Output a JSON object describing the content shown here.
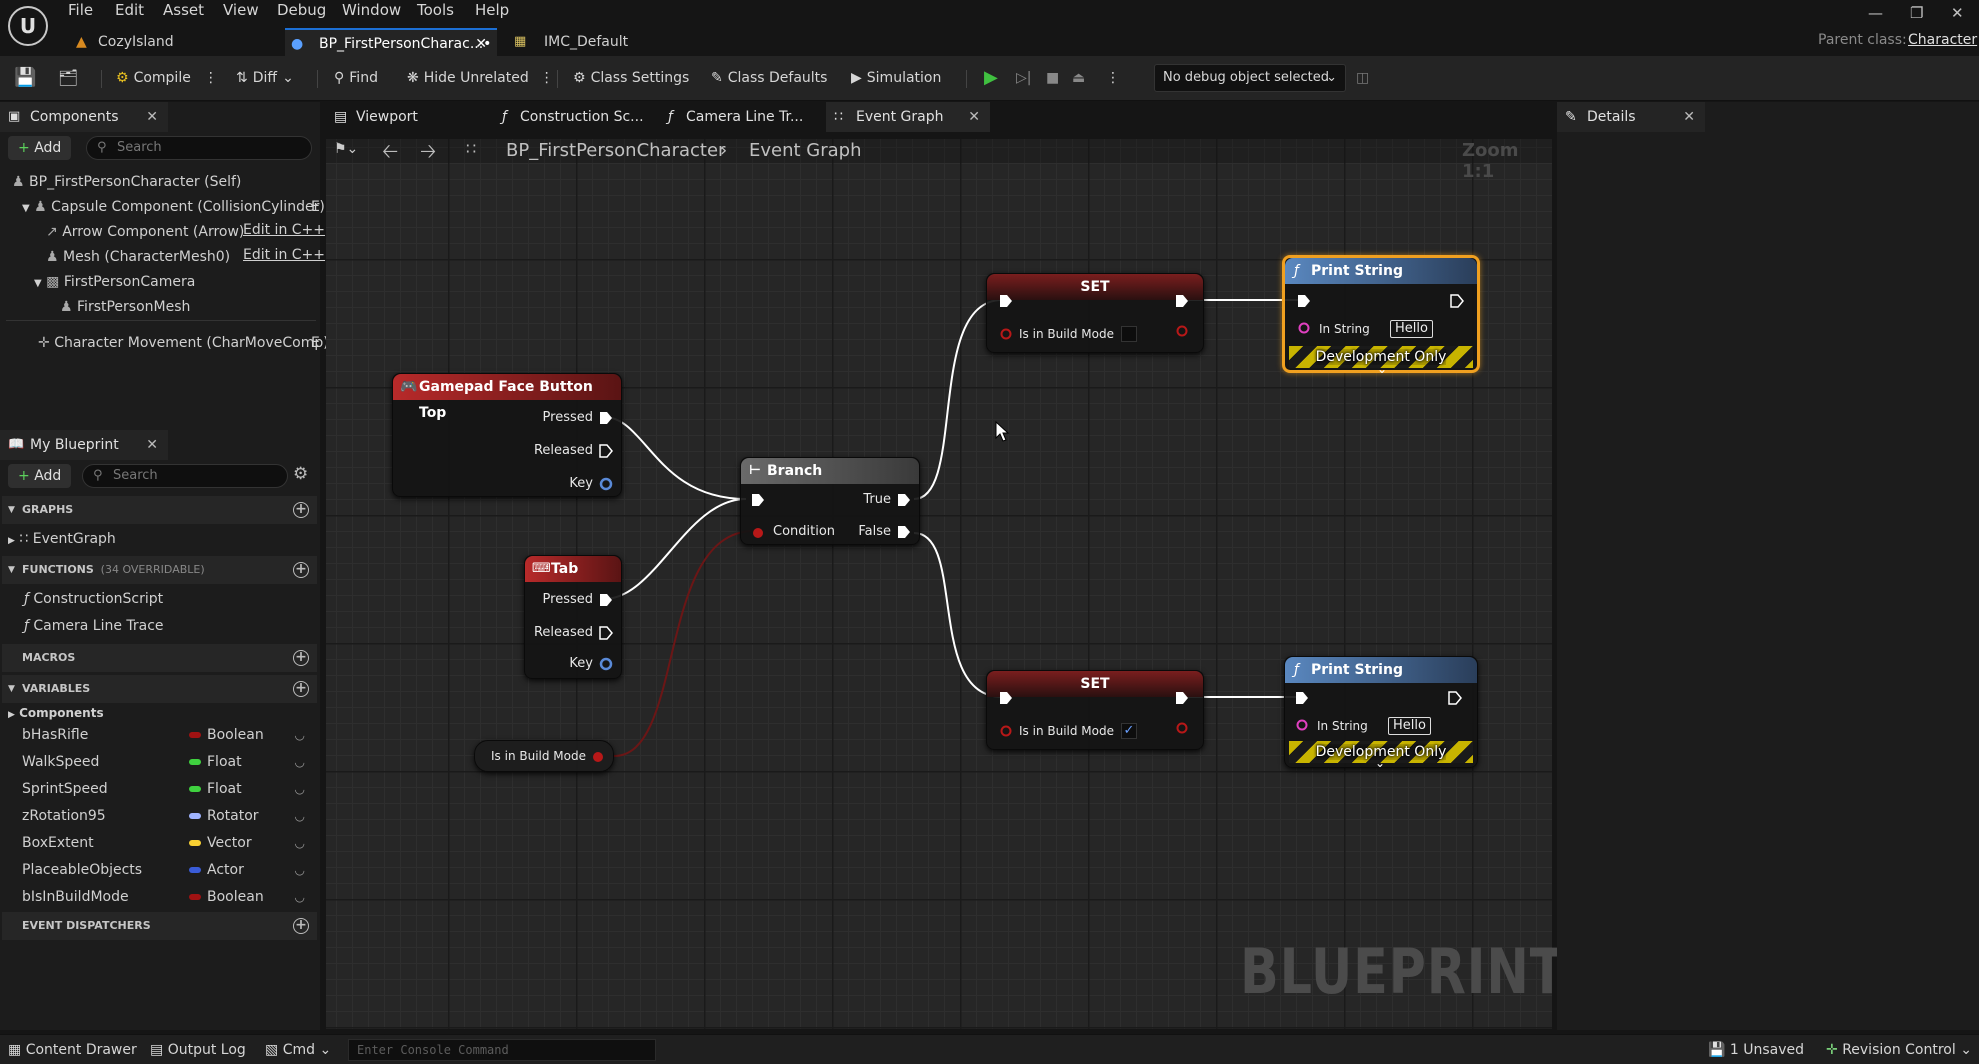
{
  "menu": [
    "File",
    "Edit",
    "Asset",
    "View",
    "Debug",
    "Window",
    "Tools",
    "Help"
  ],
  "doc_tabs": [
    {
      "label": "CozyIsland"
    },
    {
      "label": "BP_FirstPersonCharac...•"
    },
    {
      "label": "IMC_Default"
    }
  ],
  "parent_class": {
    "label": "Parent class:",
    "value": "Character"
  },
  "toolbar": {
    "compile": "Compile",
    "diff": "Diff",
    "find": "Find",
    "hide_unrelated": "Hide Unrelated",
    "class_settings": "Class Settings",
    "class_defaults": "Class Defaults",
    "simulation": "Simulation",
    "debug_object": "No debug object selected"
  },
  "components_panel": {
    "title": "Components",
    "add": "Add",
    "search_placeholder": "Search",
    "items": [
      "BP_FirstPersonCharacter (Self)",
      "Capsule Component (CollisionCylinder)",
      "Arrow Component (Arrow)",
      "Mesh (CharacterMesh0)",
      "FirstPersonCamera",
      "FirstPersonMesh",
      "Character Movement (CharMoveComp)"
    ],
    "edit_in_cpp": "Edit in C++",
    "trunc_mark": "E"
  },
  "my_blueprint": {
    "title": "My Blueprint",
    "add": "Add",
    "search_placeholder": "Search",
    "graphs_header": "GRAPHS",
    "event_graph": "EventGraph",
    "functions_header": "FUNCTIONS",
    "functions_note": "(34 OVERRIDABLE)",
    "functions": [
      "ConstructionScript",
      "Camera Line Trace"
    ],
    "macros_header": "MACROS",
    "variables_header": "VARIABLES",
    "components_category": "Components",
    "variables": [
      {
        "name": "bHasRifle",
        "type": "Boolean",
        "color": "#a01212"
      },
      {
        "name": "WalkSpeed",
        "type": "Float",
        "color": "#3fd13f"
      },
      {
        "name": "SprintSpeed",
        "type": "Float",
        "color": "#3fd13f"
      },
      {
        "name": "zRotation95",
        "type": "Rotator",
        "color": "#a0b4ff"
      },
      {
        "name": "BoxExtent",
        "type": "Vector",
        "color": "#f8d032"
      },
      {
        "name": "PlaceableObjects",
        "type": "Actor",
        "color": "#3a5cd8"
      },
      {
        "name": "bIsInBuildMode",
        "type": "Boolean",
        "color": "#a01212"
      }
    ],
    "dispatchers_header": "EVENT DISPATCHERS"
  },
  "graph_tabs": [
    "Viewport",
    "Construction Sc...",
    "Camera Line Tr...",
    "Event Graph"
  ],
  "breadcrumb": {
    "blueprint": "BP_FirstPersonCharacter",
    "graph": "Event Graph"
  },
  "zoom": "Zoom 1:1",
  "watermark": "BLUEPRINT",
  "details_title": "Details",
  "nodes": {
    "gamepad": {
      "title": "Gamepad Face Button Top",
      "pins": [
        "Pressed",
        "Released",
        "Key"
      ]
    },
    "tab": {
      "title": "Tab",
      "pins": [
        "Pressed",
        "Released",
        "Key"
      ]
    },
    "build_mode_getter": {
      "label": "Is in Build Mode"
    },
    "branch": {
      "title": "Branch",
      "condition": "Condition",
      "true": "True",
      "false": "False"
    },
    "set_top": {
      "title": "SET",
      "pin": "Is in Build Mode",
      "checked": false
    },
    "set_bottom": {
      "title": "SET",
      "pin": "Is in Build Mode",
      "checked": true
    },
    "print_top": {
      "title": "Print String",
      "in_string_label": "In String",
      "in_string": "Hello",
      "dev_only": "Development Only"
    },
    "print_bottom": {
      "title": "Print String",
      "in_string_label": "In String",
      "in_string": "Hello",
      "dev_only": "Development Only"
    }
  },
  "statusbar": {
    "content_drawer": "Content Drawer",
    "output_log": "Output Log",
    "cmd": "Cmd",
    "console_placeholder": "Enter Console Command",
    "unsaved": "1 Unsaved",
    "revision_control": "Revision Control"
  }
}
